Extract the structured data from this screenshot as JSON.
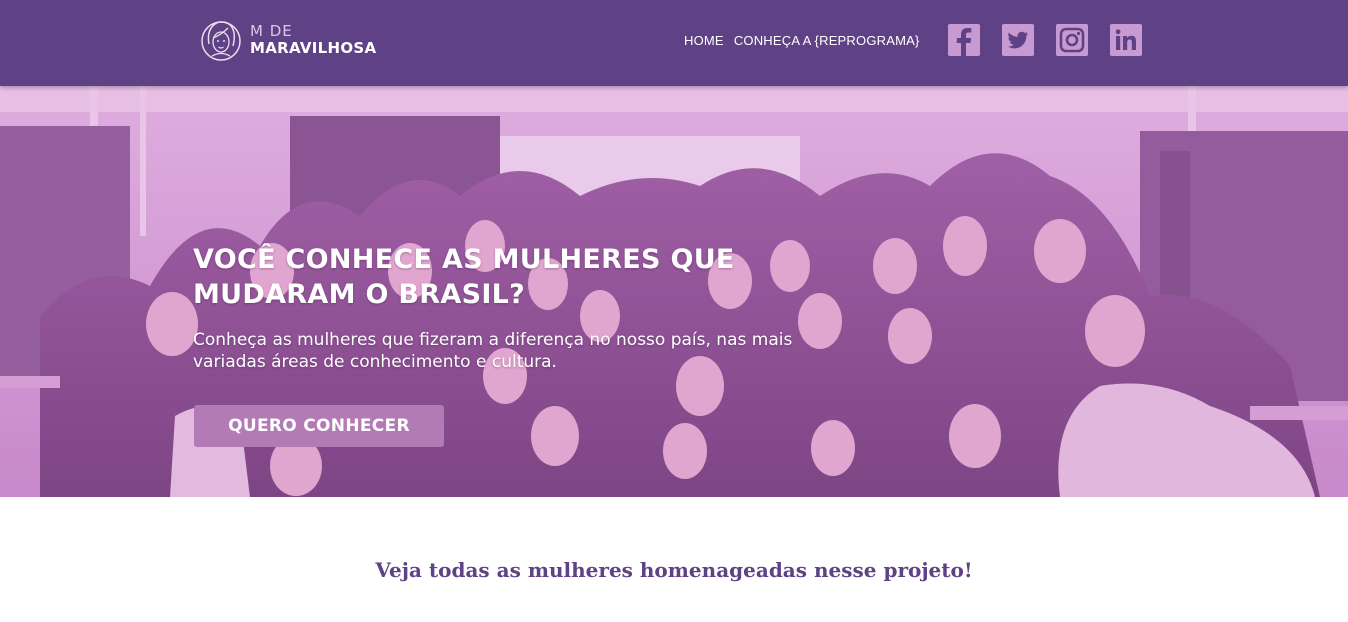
{
  "brand": {
    "line1": "M DE",
    "line2": "MARAVILHOSA",
    "logo_icon": "woman-face-logo-icon"
  },
  "nav": {
    "items": [
      {
        "label": "HOME"
      },
      {
        "label": "CONHEÇA A {REPROGRAMA}"
      }
    ]
  },
  "social": [
    {
      "icon": "facebook-icon"
    },
    {
      "icon": "twitter-icon"
    },
    {
      "icon": "instagram-icon"
    },
    {
      "icon": "linkedin-icon"
    }
  ],
  "hero": {
    "title_line1": "VOCÊ CONHECE AS MULHERES QUE",
    "title_line2": "MUDARAM O BRASIL?",
    "subtitle": "Conheça as mulheres que fizeram a diferença no nosso país, nas mais variadas áreas de conhecimento e cultura.",
    "cta_label": "QUERO CONHECER"
  },
  "section": {
    "title": "Veja todas as mulheres homenageadas nesse projeto!"
  },
  "colors": {
    "header": "#5f4286",
    "accent": "#b27bb6",
    "icon": "#c79ad2",
    "section_title": "#5f4286"
  }
}
